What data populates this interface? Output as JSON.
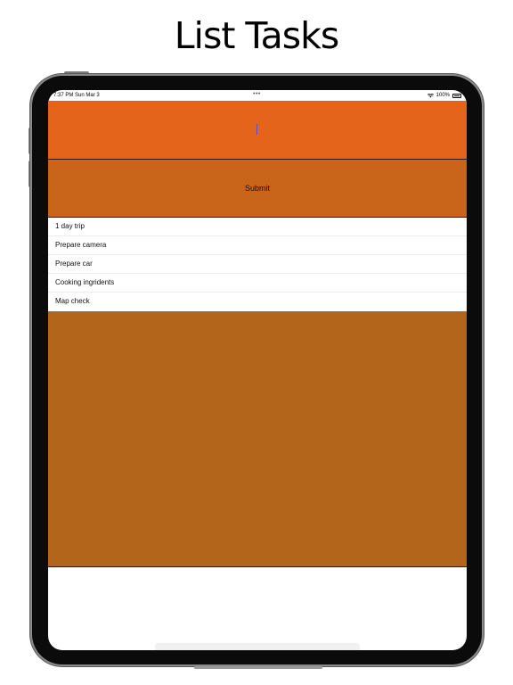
{
  "headline": "List Tasks",
  "status_bar": {
    "time": "7:37 PM  Sun Mar 3",
    "dots": "•••",
    "battery": "100%"
  },
  "task_input": {
    "value": "",
    "placeholder": ""
  },
  "submit_label": "Submit",
  "tasks": [
    "1 day trip",
    "Prepare camera",
    "Prepare car",
    "Cooking ingridents",
    "Map check"
  ],
  "colors": {
    "input_bg": "#e4641c",
    "submit_bg": "#c9651a",
    "empty_bg": "#b3661b"
  }
}
